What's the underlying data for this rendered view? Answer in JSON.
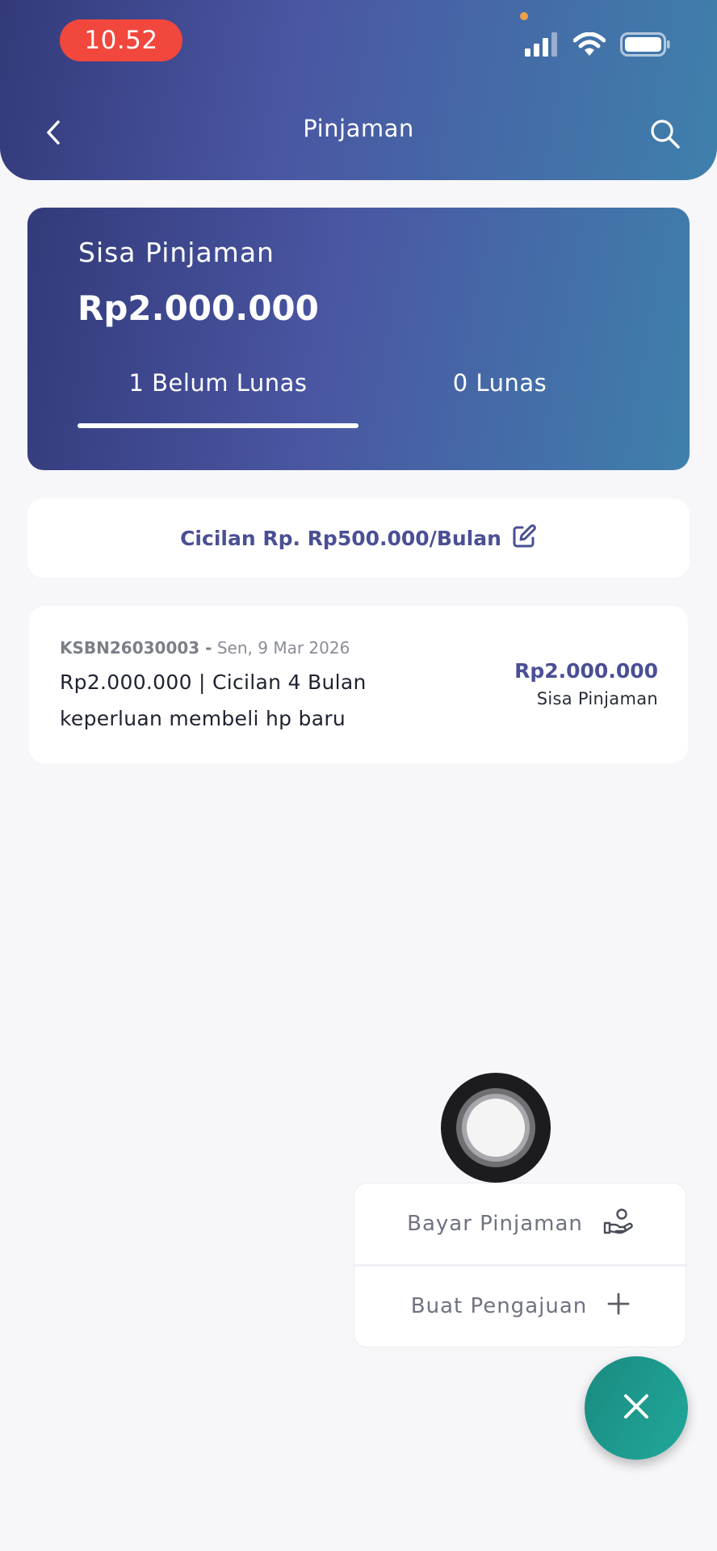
{
  "status_bar": {
    "time": "10.52"
  },
  "header": {
    "title": "Pinjaman",
    "back_icon": "chevron-left-icon",
    "search_icon": "search-icon"
  },
  "summary": {
    "label": "Sisa Pinjaman",
    "value": "Rp2.000.000",
    "tabs": [
      {
        "label": "1 Belum Lunas",
        "active": true
      },
      {
        "label": "0 Lunas",
        "active": false
      }
    ]
  },
  "installment": {
    "text": "Cicilan Rp. Rp500.000/Bulan",
    "icon": "edit-icon"
  },
  "loans": [
    {
      "code": "KSBN26030003 -",
      "date": "Sen, 9 Mar 2026",
      "line1": "Rp2.000.000 | Cicilan 4 Bulan",
      "line2": "keperluan membeli hp baru",
      "amount": "Rp2.000.000",
      "amount_label": "Sisa Pinjaman"
    }
  ],
  "fab_menu": {
    "items": [
      {
        "label": "Bayar Pinjaman",
        "icon": "hand-coin-icon"
      },
      {
        "label": "Buat Pengajuan",
        "icon": "plus-icon"
      }
    ],
    "close_icon": "close-icon"
  },
  "colors": {
    "header_gradient_start": "#333a7a",
    "header_gradient_end": "#3f80ac",
    "accent_text": "#4a4f95",
    "fab": "#1b9a8d",
    "time_pill": "#f2473d"
  }
}
